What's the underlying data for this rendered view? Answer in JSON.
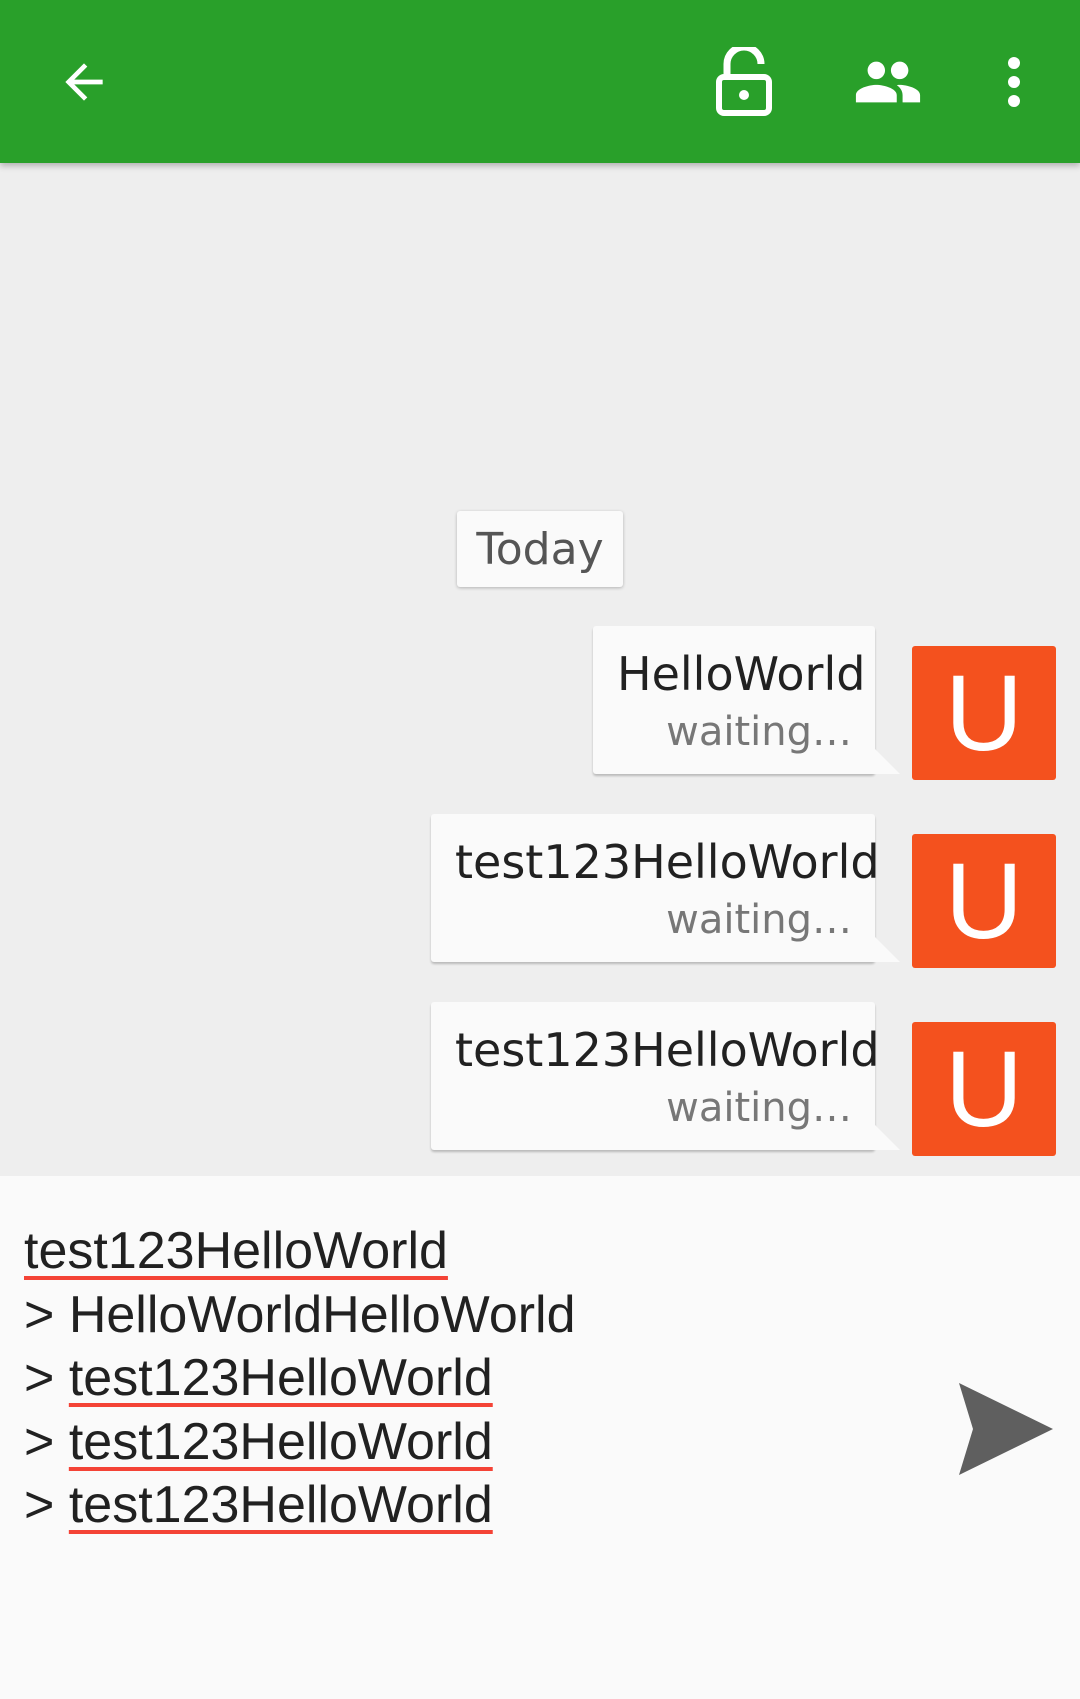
{
  "toolbar": {
    "background": "#29a02a",
    "back_icon": "arrow-left-icon",
    "lock_icon": "lock-open-icon",
    "people_icon": "people-icon",
    "more_icon": "more-vert-icon"
  },
  "chat": {
    "date_label": "Today",
    "messages": [
      {
        "text": "HelloWorld",
        "status": "waiting…",
        "avatar_letter": "U"
      },
      {
        "text": "test123HelloWorld",
        "status": "waiting…",
        "avatar_letter": "U"
      },
      {
        "text": "test123HelloWorld",
        "status": "waiting…",
        "avatar_letter": "U"
      }
    ],
    "avatar_color": "#f4511e"
  },
  "compose": {
    "lines": [
      {
        "prefix": "",
        "text": "test123HelloWorld"
      },
      {
        "prefix": "> ",
        "text": "HelloWorldHelloWorld"
      },
      {
        "prefix": "> ",
        "text": "test123HelloWorld"
      },
      {
        "prefix": "> ",
        "text": "test123HelloWorld"
      },
      {
        "prefix": "> ",
        "text": "test123HelloWorld"
      }
    ],
    "send_icon": "send-icon"
  }
}
